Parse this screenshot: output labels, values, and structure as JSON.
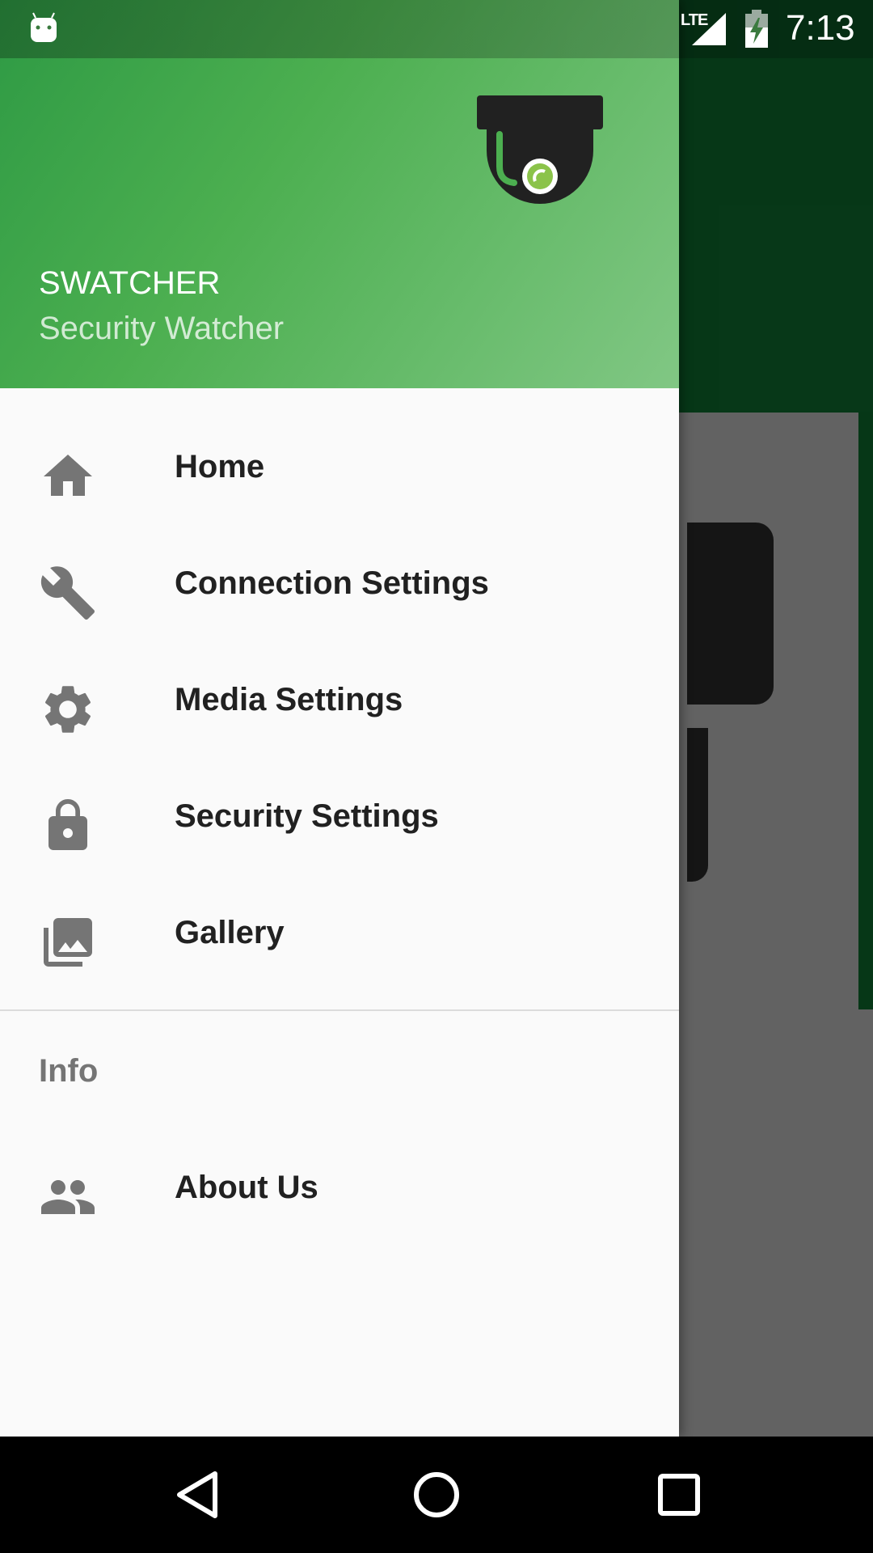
{
  "status_bar": {
    "time": "7:13",
    "network": "LTE",
    "icons": [
      "android-debug-icon",
      "signal-icon",
      "battery-charging-icon"
    ]
  },
  "drawer": {
    "header": {
      "title": "SWATCHER",
      "subtitle": "Security Watcher",
      "logo": "security-camera-icon"
    },
    "items": [
      {
        "label": "Home",
        "icon": "home-icon"
      },
      {
        "label": "Connection Settings",
        "icon": "wrench-icon"
      },
      {
        "label": "Media Settings",
        "icon": "gear-icon"
      },
      {
        "label": "Security Settings",
        "icon": "lock-icon"
      },
      {
        "label": "Gallery",
        "icon": "gallery-icon"
      }
    ],
    "info_section": {
      "title": "Info",
      "items": [
        {
          "label": "About Us",
          "icon": "people-icon"
        }
      ]
    }
  },
  "nav_bar": {
    "buttons": [
      "back-icon",
      "home-circle-icon",
      "recents-icon"
    ]
  },
  "colors": {
    "header_start": "#2e9a44",
    "header_end": "#81c784",
    "app_primary": "#0b5a26",
    "drawer_bg": "#fafafa",
    "icon_gray": "#757575"
  }
}
